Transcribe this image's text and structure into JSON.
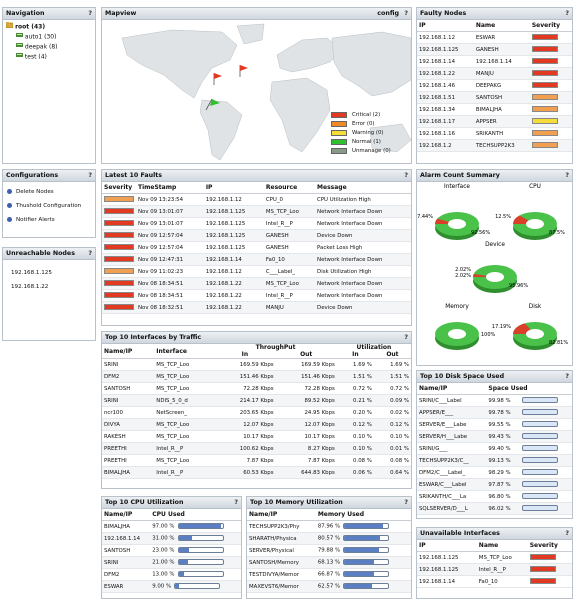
{
  "navigation": {
    "title": "Navigation",
    "help": "?",
    "root": "root (43)",
    "children": [
      "auto1 (30)",
      "deepak (8)",
      "test (4)"
    ]
  },
  "mapview": {
    "title": "Mapview",
    "config_label": "config",
    "help": "?",
    "legend": [
      {
        "label": "Critical (2)",
        "color": "#e23a22"
      },
      {
        "label": "Error (0)",
        "color": "#f08a26"
      },
      {
        "label": "Warning (0)",
        "color": "#f5dc3a"
      },
      {
        "label": "Normal (1)",
        "color": "#2fbf2f"
      },
      {
        "label": "Unmanage (0)",
        "color": "#8a9a88"
      }
    ]
  },
  "faulty_nodes": {
    "title": "Faulty Nodes",
    "help": "?",
    "headers": [
      "IP",
      "Name",
      "Severity"
    ],
    "rows": [
      {
        "ip": "192.168.1.12",
        "name": "ESWAR",
        "sev": "#e23a22"
      },
      {
        "ip": "192.168.1.125",
        "name": "GANESH",
        "sev": "#e23a22"
      },
      {
        "ip": "192.168.1.14",
        "name": "192.168.1.14",
        "sev": "#e23a22"
      },
      {
        "ip": "192.168.1.22",
        "name": "MANJU",
        "sev": "#e23a22"
      },
      {
        "ip": "192.168.1.46",
        "name": "DEEPAKG",
        "sev": "#e23a22"
      },
      {
        "ip": "192.168.1.51",
        "name": "SANTOSH",
        "sev": "#f0a050"
      },
      {
        "ip": "192.168.1.34",
        "name": "BIMALJHA",
        "sev": "#f0a050"
      },
      {
        "ip": "192.168.1.17",
        "name": "APPSER",
        "sev": "#f5dc3a"
      },
      {
        "ip": "192.168.1.16",
        "name": "SRIKANTH",
        "sev": "#f0a050"
      },
      {
        "ip": "192.168.1.2",
        "name": "TECHSUPP2K3",
        "sev": "#f0a050"
      }
    ]
  },
  "configurations": {
    "title": "Configurations",
    "help": "?",
    "items": [
      "Delete Nodes",
      "Thushold Configuration",
      "Notifier Alerts"
    ]
  },
  "unreachable": {
    "title": "Unreachable Nodes",
    "help": "?",
    "items": [
      "192.168.1.125",
      "192.168.1.22"
    ]
  },
  "latest_faults": {
    "title": "Latest 10 Faults",
    "help": "?",
    "headers": [
      "Severity",
      "TimeStamp",
      "IP",
      "Resource",
      "Message"
    ],
    "rows": [
      {
        "sev": "#f0a050",
        "time": "Nov 09 13:23:54",
        "ip": "192.168.1.12",
        "res": "CPU_0",
        "msg": "CPU Utilization High"
      },
      {
        "sev": "#e23a22",
        "time": "Nov 09 13:01:07",
        "ip": "192.168.1.125",
        "res": "MS_TCP_Loo",
        "msg": "Network Interface Down"
      },
      {
        "sev": "#e23a22",
        "time": "Nov 09 13:01:07",
        "ip": "192.168.1.125",
        "res": "Intel_R__P",
        "msg": "Network Interface Down"
      },
      {
        "sev": "#e23a22",
        "time": "Nov 09 12:57:04",
        "ip": "192.168.1.125",
        "res": "GANESH",
        "msg": "Device Down"
      },
      {
        "sev": "#e23a22",
        "time": "Nov 09 12:57:04",
        "ip": "192.168.1.125",
        "res": "GANESH",
        "msg": "Packet Loss High"
      },
      {
        "sev": "#e23a22",
        "time": "Nov 09 12:47:31",
        "ip": "192.168.1.14",
        "res": "Fa0_10",
        "msg": "Network Interface Down"
      },
      {
        "sev": "#f0a050",
        "time": "Nov 09 11:02:23",
        "ip": "192.168.1.12",
        "res": "C___Label_",
        "msg": "Disk Utilization High"
      },
      {
        "sev": "#e23a22",
        "time": "Nov 08 18:34:51",
        "ip": "192.168.1.22",
        "res": "MS_TCP_Loo",
        "msg": "Network Interface Down"
      },
      {
        "sev": "#e23a22",
        "time": "Nov 08 18:34:51",
        "ip": "192.168.1.22",
        "res": "Intel_R__P",
        "msg": "Network Interface Down"
      },
      {
        "sev": "#e23a22",
        "time": "Nov 08 18:32:51",
        "ip": "192.168.1.22",
        "res": "MANJU",
        "msg": "Device Down"
      }
    ]
  },
  "alarm_summary": {
    "title": "Alarm Count Summary",
    "help": "?",
    "charts": [
      {
        "label": "Interface",
        "a": "7.44%",
        "b": "92.56%",
        "red": 7.44
      },
      {
        "label": "CPU",
        "a": "12.5%",
        "b": "87.5%",
        "red": 12.5
      },
      {
        "label": "Device",
        "a": "2.02%",
        "a2": "2.02%",
        "b": "95.96%",
        "red": 4.04
      },
      {
        "label": "Memory",
        "a": "",
        "b": "100%",
        "red": 0
      },
      {
        "label": "Disk",
        "a": "17.19%",
        "b": "82.81%",
        "red": 17.19
      }
    ]
  },
  "top_interfaces": {
    "title": "Top 10 Interfaces by Traffic",
    "help": "?",
    "headers": [
      "Name/IP",
      "Interface",
      "ThroughPut",
      "Utilization"
    ],
    "sub": [
      "In",
      "Out",
      "In",
      "Out"
    ],
    "rows": [
      {
        "name": "SRINI",
        "iface": "MS_TCP_Loo",
        "tin": "169.59 Kbps",
        "tout": "169.59 Kbps",
        "uin": "1.69 %",
        "uout": "1.69 %"
      },
      {
        "name": "DFM2",
        "iface": "MS_TCP_Loo",
        "tin": "151.46 Kbps",
        "tout": "151.46 Kbps",
        "uin": "1.51 %",
        "uout": "1.51 %"
      },
      {
        "name": "SANTOSH",
        "iface": "MS_TCP_Loo",
        "tin": "72.28 Kbps",
        "tout": "72.28 Kbps",
        "uin": "0.72 %",
        "uout": "0.72 %"
      },
      {
        "name": "SRINI",
        "iface": "NDIS_5_0_d",
        "tin": "214.17 Kbps",
        "tout": "89.52 Kbps",
        "uin": "0.21 %",
        "uout": "0.09 %"
      },
      {
        "name": "ncr100",
        "iface": "NetScreen_",
        "tin": "203.65 Kbps",
        "tout": "24.95 Kbps",
        "uin": "0.20 %",
        "uout": "0.02 %"
      },
      {
        "name": "DIVYA",
        "iface": "MS_TCP_Loo",
        "tin": "12.07 Kbps",
        "tout": "12.07 Kbps",
        "uin": "0.12 %",
        "uout": "0.12 %"
      },
      {
        "name": "RAKESH",
        "iface": "MS_TCP_Loo",
        "tin": "10.17 Kbps",
        "tout": "10.17 Kbps",
        "uin": "0.10 %",
        "uout": "0.10 %"
      },
      {
        "name": "PREETHI",
        "iface": "Intel_R__P",
        "tin": "100.62 Kbps",
        "tout": "8.27 Kbps",
        "uin": "0.10 %",
        "uout": "0.01 %"
      },
      {
        "name": "PREETHI",
        "iface": "MS_TCP_Loo",
        "tin": "7.87 Kbps",
        "tout": "7.87 Kbps",
        "uin": "0.08 %",
        "uout": "0.08 %"
      },
      {
        "name": "BIMALJHA",
        "iface": "Intel_R__P",
        "tin": "60.53 Kbps",
        "tout": "644.83 Kbps",
        "uin": "0.06 %",
        "uout": "0.64 %"
      }
    ]
  },
  "top_disk": {
    "title": "Top 10 Disk Space Used",
    "help": "?",
    "headers": [
      "Name/IP",
      "Space Used"
    ],
    "rows": [
      {
        "name": "SRINI/C___Label",
        "val": "99.98 %"
      },
      {
        "name": "APPSER/E___",
        "val": "99.78 %"
      },
      {
        "name": "SERVER/E___Labe",
        "val": "99.55 %"
      },
      {
        "name": "SERVER/H___Labe",
        "val": "99.43 %"
      },
      {
        "name": "SRINI/G___",
        "val": "99.40 %"
      },
      {
        "name": "TECHSUPP2K3/C__",
        "val": "99.13 %"
      },
      {
        "name": "DFM2/C___Label_",
        "val": "98.29 %"
      },
      {
        "name": "ESWAR/C___Label",
        "val": "97.87 %"
      },
      {
        "name": "SRIKANTH/C___La",
        "val": "96.80 %"
      },
      {
        "name": "SQLSERVER/D___L",
        "val": "96.02 %"
      }
    ]
  },
  "top_cpu": {
    "title": "Top 10 CPU Utilization",
    "help": "?",
    "headers": [
      "Name/IP",
      "CPU Used"
    ],
    "rows": [
      {
        "name": "BIMALJHA",
        "val": "97.00 %",
        "pct": 97
      },
      {
        "name": "192.168.1.14",
        "val": "31.00 %",
        "pct": 31
      },
      {
        "name": "SANTOSH",
        "val": "23.00 %",
        "pct": 23
      },
      {
        "name": "SRINI",
        "val": "21.00 %",
        "pct": 21
      },
      {
        "name": "DFM2",
        "val": "13.00 %",
        "pct": 13
      },
      {
        "name": "ESWAR",
        "val": "9.00 %",
        "pct": 9
      }
    ]
  },
  "top_memory": {
    "title": "Top 10 Memory Utilization",
    "help": "?",
    "headers": [
      "Name/IP",
      "Memory Used"
    ],
    "rows": [
      {
        "name": "TECHSUPP2K3/Phy",
        "val": "87.96 %",
        "pct": 87.96
      },
      {
        "name": "SHARATH/Physica",
        "val": "80.57 %",
        "pct": 80.57
      },
      {
        "name": "SERVER/Physical",
        "val": "79.88 %",
        "pct": 79.88
      },
      {
        "name": "SANTOSH/Memory",
        "val": "68.13 %",
        "pct": 68.13
      },
      {
        "name": "TESTDIVYA/Memor",
        "val": "66.87 %",
        "pct": 66.87
      },
      {
        "name": "MAXEVST6/Memor",
        "val": "62.57 %",
        "pct": 62.57
      }
    ]
  },
  "unavailable": {
    "title": "Unavailable Interfaces",
    "help": "?",
    "headers": [
      "IP",
      "Name",
      "Severity"
    ],
    "rows": [
      {
        "ip": "192.168.1.125",
        "name": "MS_TCP_Loo",
        "sev": "#e23a22"
      },
      {
        "ip": "192.168.1.125",
        "name": "Intel_R__P",
        "sev": "#e23a22"
      },
      {
        "ip": "192.168.1.14",
        "name": "Fa0_10",
        "sev": "#e23a22"
      }
    ]
  }
}
